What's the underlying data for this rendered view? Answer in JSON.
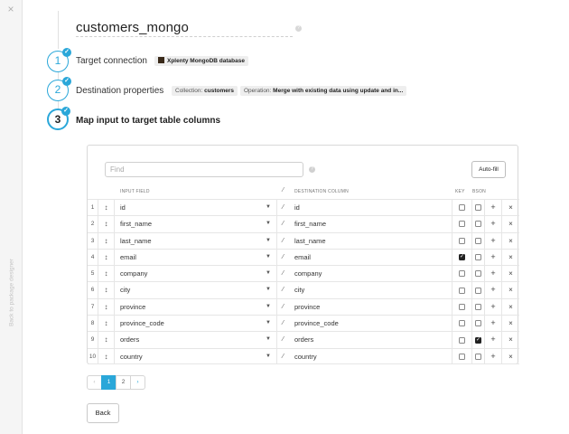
{
  "sidebar": {
    "close_label": "×",
    "back_label": "Back to package designer"
  },
  "header": {
    "title": "customers_mongo",
    "help": "?"
  },
  "steps": [
    {
      "number": "1",
      "label": "Target connection",
      "done": true
    },
    {
      "number": "2",
      "label": "Destination properties",
      "done": true
    },
    {
      "number": "3",
      "label": "Map input to target table columns",
      "done": true
    }
  ],
  "connection": {
    "name": "Xplenty MongoDB database"
  },
  "destination": {
    "collection_label": "Collection:",
    "collection_value": "customers",
    "operation_label": "Operation:",
    "operation_value": "Merge with existing data using update and in..."
  },
  "mapping": {
    "find_placeholder": "Find",
    "find_help": "?",
    "autofill_label": "Auto-fill",
    "headers": {
      "input": "INPUT FIELD",
      "destination": "DESTINATION COLUMN",
      "key": "KEY",
      "bson": "BSON"
    },
    "rows": [
      {
        "n": "1",
        "input": "id",
        "dest": "id",
        "key": false,
        "bson": false
      },
      {
        "n": "2",
        "input": "first_name",
        "dest": "first_name",
        "key": false,
        "bson": false
      },
      {
        "n": "3",
        "input": "last_name",
        "dest": "last_name",
        "key": false,
        "bson": false
      },
      {
        "n": "4",
        "input": "email",
        "dest": "email",
        "key": true,
        "bson": false
      },
      {
        "n": "5",
        "input": "company",
        "dest": "company",
        "key": false,
        "bson": false
      },
      {
        "n": "6",
        "input": "city",
        "dest": "city",
        "key": false,
        "bson": false
      },
      {
        "n": "7",
        "input": "province",
        "dest": "province",
        "key": false,
        "bson": false
      },
      {
        "n": "8",
        "input": "province_code",
        "dest": "province_code",
        "key": false,
        "bson": false
      },
      {
        "n": "9",
        "input": "orders",
        "dest": "orders",
        "key": false,
        "bson": true
      },
      {
        "n": "10",
        "input": "country",
        "dest": "country",
        "key": false,
        "bson": false
      }
    ]
  },
  "pagination": {
    "prev": "‹",
    "pages": [
      "1",
      "2"
    ],
    "current": "1",
    "next": "›"
  },
  "footer": {
    "back_label": "Back"
  },
  "colors": {
    "accent": "#2aa7d9"
  }
}
